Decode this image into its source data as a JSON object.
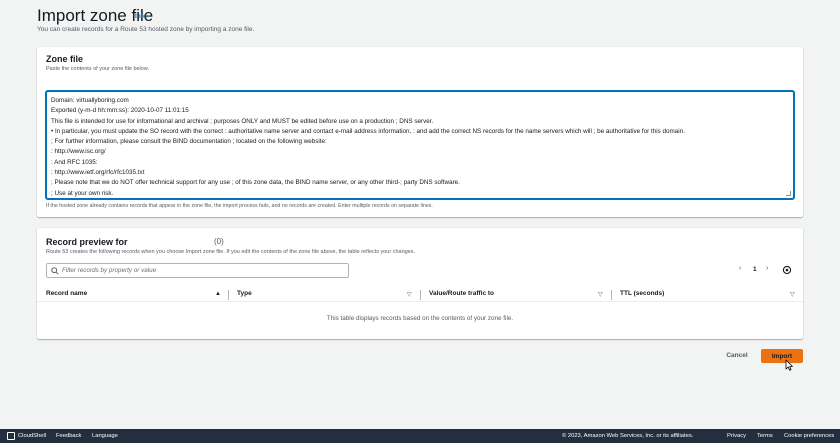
{
  "header": {
    "title": "Import zone file",
    "info_link": "Info",
    "description": "You can create records for a Route 53 hosted zone by importing a zone file."
  },
  "zone_file": {
    "title": "Zone file",
    "subtitle": "Paste the contents of your zone file below.",
    "lines": [
      "Domain: virtuallyboring.com",
      "Exported (y-m-d hh:mm:ss): 2020-10-07 11:01:15",
      "This file is intended for use for informational and archival ; purposes ONLY and MUST be edited before use on a production ; DNS server.",
      "• In particular, you must update the SO record with the correct : authoritative name server and contact e-mail address information, : and add the correct NS records for the name servers which will ; be authoritative for this domain.",
      "; For further information, please consult the BIND documentation ; located on the following website:",
      ": http://www.isc.org/",
      ": And RFC 1035:",
      ": http://www.ietf.org/rfc/rfc1035.txt",
      "; Please note that we do NOT offer technical support for any use ; of this zone data, the BIND name server, or any other third-; party DNS software.",
      "; Use at your own risk."
    ],
    "hint": "If the hosted zone already contains records that appear in the zone file, the import process fails, and no records are created. Enter multiple records on separate lines."
  },
  "record_preview": {
    "title": "Record preview for",
    "count": "(0)",
    "subtitle": "Route 53 creates the following records when you choose Import zone file. If you edit the contents of the zone file above, the table reflects your changes.",
    "filter_placeholder": "Filter records by property or value",
    "pager": {
      "prev": "‹",
      "page": "1",
      "next": "›"
    },
    "columns": [
      {
        "label": "Record name",
        "sort": "▲"
      },
      {
        "label": "Type",
        "sort": "▽"
      },
      {
        "label": "Value/Route traffic to",
        "sort": "▽"
      },
      {
        "label": "TTL (seconds)",
        "sort": "▽"
      }
    ],
    "empty_message": "This table displays records based on the contents of your zone file."
  },
  "actions": {
    "cancel": "Cancel",
    "import": "Import"
  },
  "footer": {
    "cloudshell": "CloudShell",
    "feedback": "Feedback",
    "language": "Language",
    "copyright": "© 2023, Amazon Web Services, Inc. or its affiliates.",
    "privacy": "Privacy",
    "terms": "Terms",
    "cookies": "Cookie preferences"
  },
  "colors": {
    "accent": "#0073bb",
    "primary_button": "#ec7211",
    "footer_bg": "#232f3e"
  }
}
